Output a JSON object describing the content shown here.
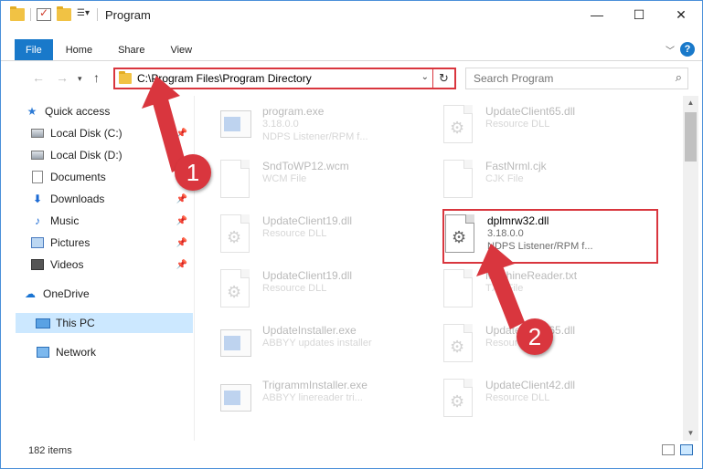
{
  "window": {
    "title": "Program",
    "min": "—",
    "max": "☐",
    "close": "✕"
  },
  "ribbon": {
    "tabs": [
      "File",
      "Home",
      "Share",
      "View"
    ]
  },
  "address": {
    "path": "C:\\Program Files\\Program Directory",
    "search_placeholder": "Search Program"
  },
  "sidebar": {
    "items": [
      {
        "label": "Quick access",
        "pinned": false
      },
      {
        "label": "Local Disk (C:)",
        "pinned": true
      },
      {
        "label": "Local Disk (D:)",
        "pinned": false
      },
      {
        "label": "Documents",
        "pinned": false
      },
      {
        "label": "Downloads",
        "pinned": true
      },
      {
        "label": "Music",
        "pinned": true
      },
      {
        "label": "Pictures",
        "pinned": true
      },
      {
        "label": "Videos",
        "pinned": true
      },
      {
        "label": "OneDrive",
        "pinned": false
      },
      {
        "label": "This PC",
        "pinned": false
      },
      {
        "label": "Network",
        "pinned": false
      }
    ]
  },
  "files": [
    {
      "name": "program.exe",
      "line1": "3.18.0.0",
      "line2": "NDPS Listener/RPM f...",
      "icon": "exe-icon"
    },
    {
      "name": "UpdateClient65.dll",
      "line1": "Resource DLL",
      "line2": "",
      "icon": "dll-icon"
    },
    {
      "name": "SndToWP12.wcm",
      "line1": "WCM File",
      "line2": "",
      "icon": "document-icon"
    },
    {
      "name": "FastNrml.cjk",
      "line1": "CJK File",
      "line2": "",
      "icon": "document-icon"
    },
    {
      "name": "UpdateClient19.dll",
      "line1": "Resource DLL",
      "line2": "",
      "icon": "dll-icon"
    },
    {
      "name": "dplmrw32.dll",
      "line1": "3.18.0.0",
      "line2": "NDPS Listener/RPM f...",
      "icon": "dll-icon"
    },
    {
      "name": "UpdateClient19.dll",
      "line1": "Resource DLL",
      "line2": "",
      "icon": "dll-icon"
    },
    {
      "name": "MachineReader.txt",
      "line1": "TXT File",
      "line2": "",
      "icon": "document-icon"
    },
    {
      "name": "UpdateInstaller.exe",
      "line1": "ABBYY updates installer",
      "line2": "",
      "icon": "exe-icon"
    },
    {
      "name": "UpdateClient65.dll",
      "line1": "Resource DLL",
      "line2": "",
      "icon": "dll-icon"
    },
    {
      "name": "TrigrammInstaller.exe",
      "line1": "ABBYY linereader tri...",
      "line2": "",
      "icon": "exe-icon"
    },
    {
      "name": "UpdateClient42.dll",
      "line1": "Resource DLL",
      "line2": "",
      "icon": "dll-icon"
    }
  ],
  "status": {
    "count": "182 items"
  },
  "annotations": {
    "step1": "1",
    "step2": "2",
    "color": "#d9363e"
  }
}
